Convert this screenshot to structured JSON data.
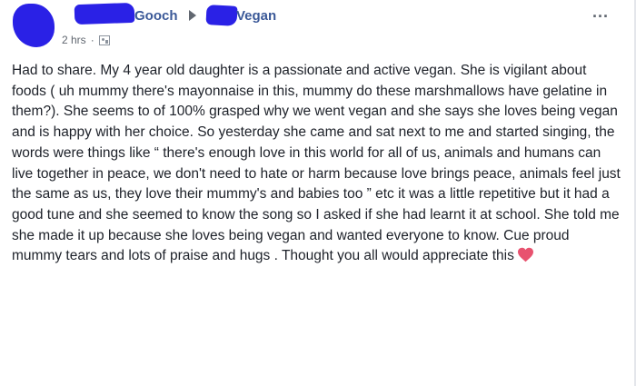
{
  "post": {
    "author_name": "Gooch",
    "group_name": "Vegan",
    "time": "2 hrs",
    "dot": "·",
    "more_label": "...",
    "text": "Had to share. My 4 year old daughter is a passionate and active vegan. She is vigilant about foods ( uh mummy there's mayonnaise in this, mummy do these marshmallows have gelatine in them?). She seems to of 100% grasped why we went vegan and she says she loves being vegan and is happy with her choice. So yesterday she came and sat next to me and started singing, the words were things like “ there's enough love in this world for all of us, animals and humans can live together in peace, we don't need to hate or harm because love brings peace, animals feel just the same as us, they love their mummy's and babies too ” etc it was a little repetitive but it had a good tune and she seemed to know the song so I asked if she had learnt it at school. She told me she made it up because she loves being vegan and wanted everyone to know. Cue proud mummy tears and lots of praise and hugs . Thought you all would appreciate this",
    "heart_icon": "heart-icon",
    "heart_color": "#e8526f",
    "redaction_color": "#2a21e6",
    "link_color": "#3b5998"
  }
}
